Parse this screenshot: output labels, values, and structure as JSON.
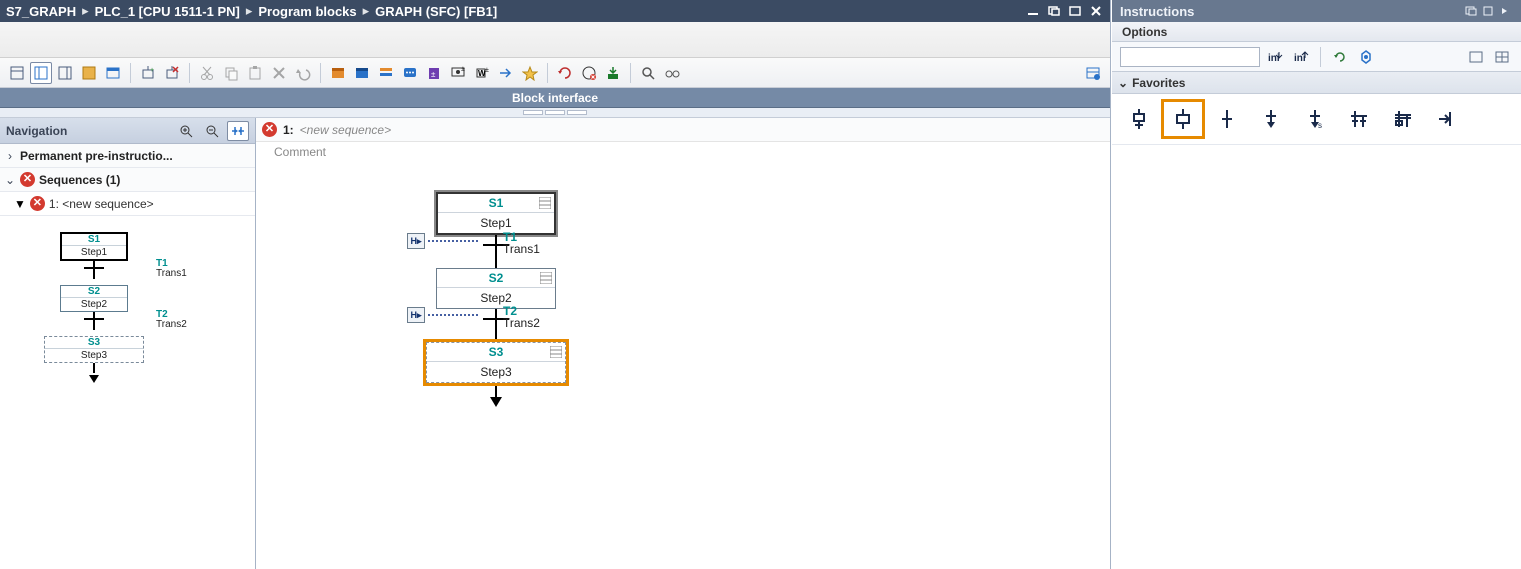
{
  "titlebar": {
    "crumbs": [
      "S7_GRAPH",
      "PLC_1 [CPU 1511-1 PN]",
      "Program blocks",
      "GRAPH (SFC) [FB1]"
    ]
  },
  "block_interface_label": "Block interface",
  "nav": {
    "title": "Navigation",
    "row_pre": "Permanent pre-instructio...",
    "row_seq": "Sequences (1)",
    "row_seq_item": "1: <new sequence>"
  },
  "mini_graph": {
    "steps": [
      {
        "id": "S1",
        "name": "Step1",
        "init": true,
        "new": false
      },
      {
        "id": "S2",
        "name": "Step2",
        "init": false,
        "new": false
      },
      {
        "id": "S3",
        "name": "Step3",
        "init": false,
        "new": true
      }
    ],
    "trans": [
      {
        "id": "T1",
        "name": "Trans1"
      },
      {
        "id": "T2",
        "name": "Trans2"
      }
    ]
  },
  "canvas": {
    "seq_no": "1:",
    "seq_name": "<new sequence>",
    "comment": "Comment",
    "steps": [
      {
        "id": "S1",
        "name": "Step1",
        "init": true,
        "hl": false
      },
      {
        "id": "S2",
        "name": "Step2",
        "init": false,
        "hl": false
      },
      {
        "id": "S3",
        "name": "Step3",
        "init": false,
        "hl": true
      }
    ],
    "trans": [
      {
        "id": "T1",
        "name": "Trans1"
      },
      {
        "id": "T2",
        "name": "Trans2"
      }
    ]
  },
  "side": {
    "title": "Instructions",
    "options_label": "Options",
    "favorites_label": "Favorites",
    "search_placeholder": ""
  },
  "favorites": [
    {
      "name": "step-and-transition-icon",
      "hl": false
    },
    {
      "name": "step-icon",
      "hl": true
    },
    {
      "name": "transition-icon",
      "hl": false
    },
    {
      "name": "sequence-end-icon",
      "hl": false
    },
    {
      "name": "jump-icon",
      "hl": false
    },
    {
      "name": "alternative-branch-icon",
      "hl": false
    },
    {
      "name": "simultaneous-branch-icon",
      "hl": false
    },
    {
      "name": "close-branch-icon",
      "hl": false
    }
  ]
}
